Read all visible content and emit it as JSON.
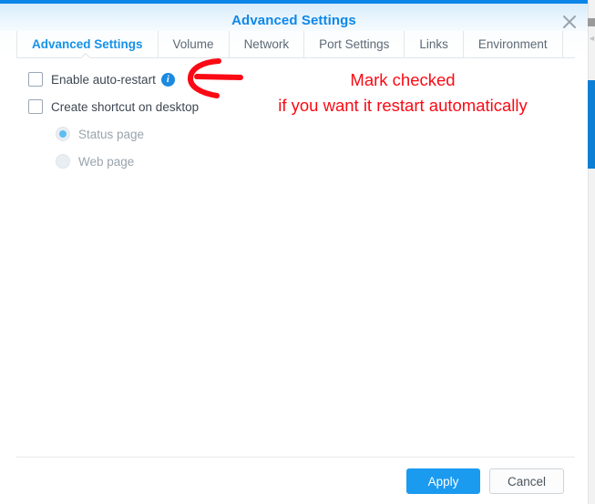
{
  "window": {
    "title": "Advanced Settings",
    "close_label": "×",
    "accent_color": "#0b85e8",
    "title_color": "#0d87e9"
  },
  "tabs": [
    {
      "label": "Advanced Settings",
      "active": true
    },
    {
      "label": "Volume",
      "active": false
    },
    {
      "label": "Network",
      "active": false
    },
    {
      "label": "Port Settings",
      "active": false
    },
    {
      "label": "Links",
      "active": false
    },
    {
      "label": "Environment",
      "active": false
    }
  ],
  "form": {
    "enable_auto_restart": {
      "label": "Enable auto-restart",
      "checked": false,
      "info_glyph": "i"
    },
    "create_shortcut": {
      "label": "Create shortcut on desktop",
      "checked": false
    },
    "shortcut_target": {
      "options": [
        {
          "label": "Status page",
          "selected": true
        },
        {
          "label": "Web page",
          "selected": false
        }
      ]
    }
  },
  "annotation": {
    "line1": "Mark checked",
    "line2": "if you want it restart automatically",
    "color": "#fa0a14",
    "arrow": "left-arrow"
  },
  "footer": {
    "apply_label": "Apply",
    "cancel_label": "Cancel",
    "apply_color": "#1b9bf0"
  },
  "scrollbar": {
    "thumb_color": "#0d7fd4",
    "arrow_glyph": "◄"
  }
}
